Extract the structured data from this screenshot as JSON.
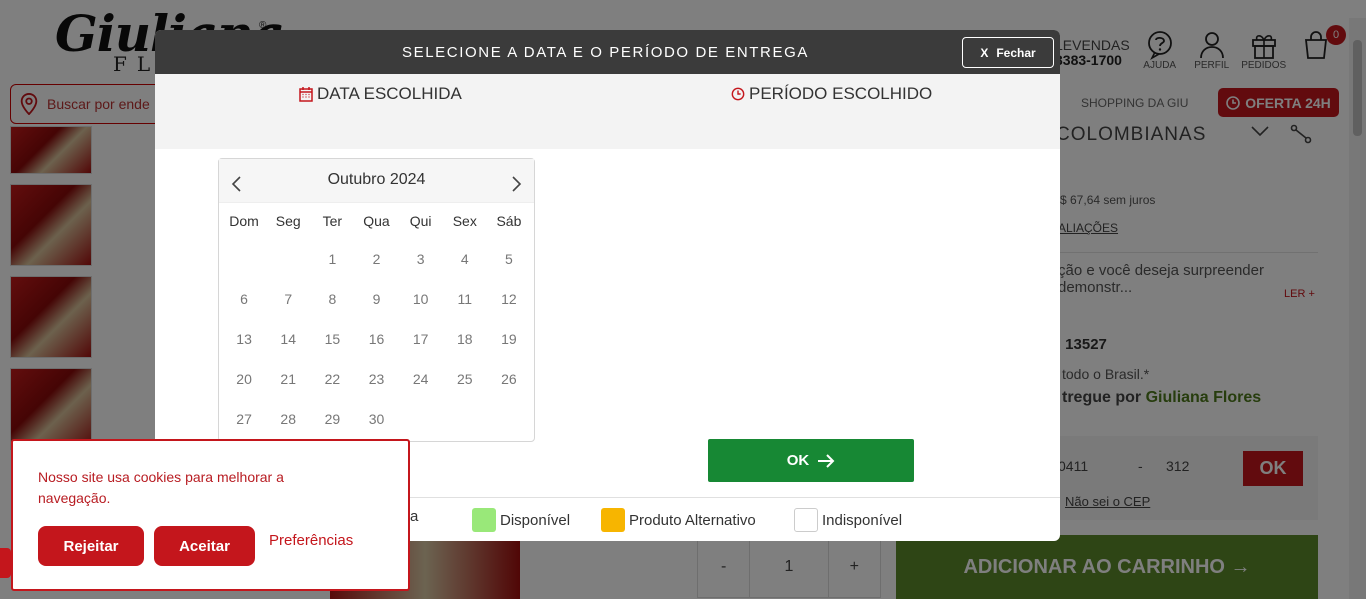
{
  "header": {
    "logo_main": "Giuliana",
    "logo_sub": "FLORES",
    "logo_reg": "®",
    "search_placeholder": "Buscar por ende",
    "phone_label": "LEVENDAS",
    "phone_number": "3383-1700",
    "icons": [
      {
        "icon": "help-icon",
        "label": "AJUDA"
      },
      {
        "icon": "user-icon",
        "label": "PERFIL"
      },
      {
        "icon": "gift-icon",
        "label": "PEDIDOS"
      }
    ],
    "cart_count": "0",
    "shop_link": "SHOPPING DA GIU",
    "oferta_label": "OFERTA 24H"
  },
  "product": {
    "title": "COLOMBIANAS",
    "installment": "$ 67,64 sem juros",
    "avaliacoes": "ALIAÇÕES",
    "description": "ção e você deseja surpreender\n demonstr...",
    "read_more": "LER +",
    "code": ": 13527",
    "brasil": "todo o Brasil.*",
    "entregue_prefix": "tregue por",
    "entregue_brand": "Giuliana Flores",
    "cep_part1": "0411",
    "cep_dash": "-",
    "cep_part2": "312",
    "cep_ok": "OK",
    "cep_unknown": "Não sei o CEP",
    "qty_minus": "-",
    "qty_value": "1",
    "qty_plus": "+",
    "add_to_cart": "ADICIONAR AO CARRINHO →"
  },
  "modal": {
    "title": "SELECIONE A DATA E O PERÍODO DE ENTREGA",
    "close_x": "X",
    "close_label": "Fechar",
    "date_chosen": "DATA ESCOLHIDA",
    "period_chosen": "PERÍODO ESCOLHIDO",
    "ok_label": "OK",
    "calendar": {
      "month": "Outubro 2024",
      "weekdays": [
        "Dom",
        "Seg",
        "Ter",
        "Qua",
        "Qui",
        "Sex",
        "Sáb"
      ],
      "leading_blanks": 2,
      "days": [
        "1",
        "2",
        "3",
        "4",
        "5",
        "6",
        "7",
        "8",
        "9",
        "10",
        "11",
        "12",
        "13",
        "14",
        "15",
        "16",
        "17",
        "18",
        "19",
        "20",
        "21",
        "22",
        "23",
        "24",
        "25",
        "26",
        "27",
        "28",
        "29",
        "30"
      ]
    },
    "legend": [
      {
        "label": "nada",
        "color": ""
      },
      {
        "label": "Disponível",
        "color": "#99e879"
      },
      {
        "label": "Produto Alternativo",
        "color": "#f7b500"
      },
      {
        "label": "Indisponível",
        "color": "#ffffff"
      }
    ]
  },
  "cookie": {
    "text": "Nosso site usa cookies para melhorar a navegação.",
    "reject": "Rejeitar",
    "accept": "Aceitar",
    "preferences": "Preferências"
  },
  "colors": {
    "brand_red": "#c4161c",
    "ok_green": "#178834",
    "header_dark": "#3b3b3b"
  }
}
